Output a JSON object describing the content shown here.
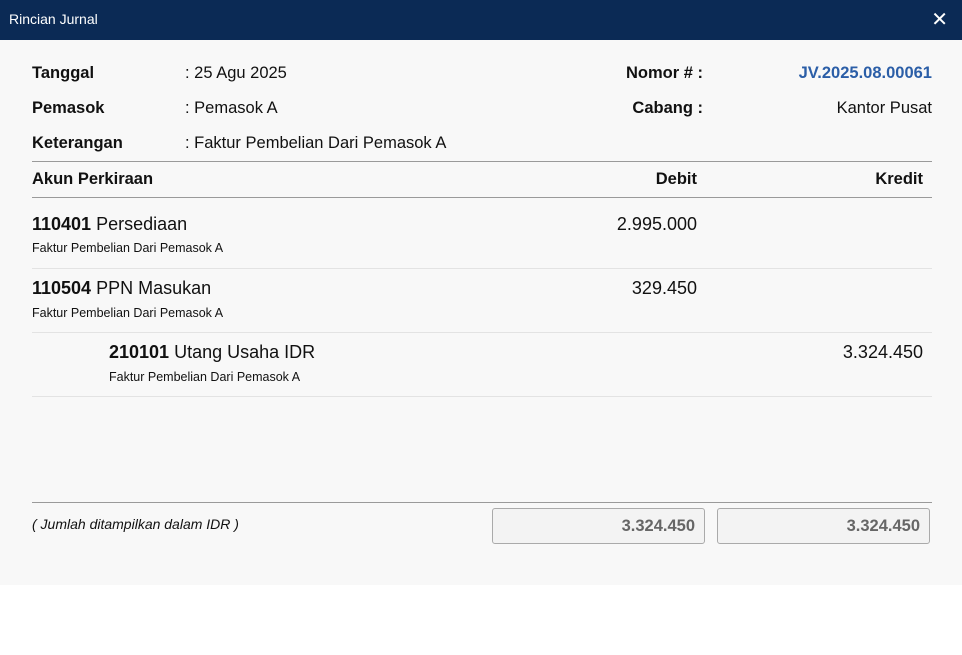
{
  "dialog": {
    "title": "Rincian Jurnal",
    "close_icon": "close-icon"
  },
  "header": {
    "tanggal_label": "Tanggal",
    "tanggal_value": ": 25 Agu 2025",
    "pemasok_label": "Pemasok",
    "pemasok_value": ": Pemasok A",
    "keterangan_label": "Keterangan",
    "keterangan_value": ": Faktur Pembelian Dari Pemasok A",
    "nomor_label": "Nomor # :",
    "nomor_value": "JV.2025.08.00061",
    "cabang_label": "Cabang :",
    "cabang_value": "Kantor Pusat",
    "link_color": "#2b5ea7"
  },
  "table": {
    "columns": {
      "account": "Akun Perkiraan",
      "debit": "Debit",
      "credit": "Kredit"
    },
    "rows": [
      {
        "code": "110401",
        "name": "Persediaan",
        "desc": "Faktur Pembelian Dari Pemasok A",
        "debit": "2.995.000",
        "credit": ""
      },
      {
        "code": "110504",
        "name": "PPN Masukan",
        "desc": "Faktur Pembelian Dari Pemasok A",
        "debit": "329.450",
        "credit": ""
      },
      {
        "code": "210101",
        "name": "Utang Usaha IDR",
        "desc": "Faktur Pembelian Dari Pemasok A",
        "debit": "",
        "credit": "3.324.450"
      }
    ]
  },
  "footer": {
    "note": "( Jumlah ditampilkan dalam IDR )",
    "total_debit": "3.324.450",
    "total_credit": "3.324.450"
  }
}
